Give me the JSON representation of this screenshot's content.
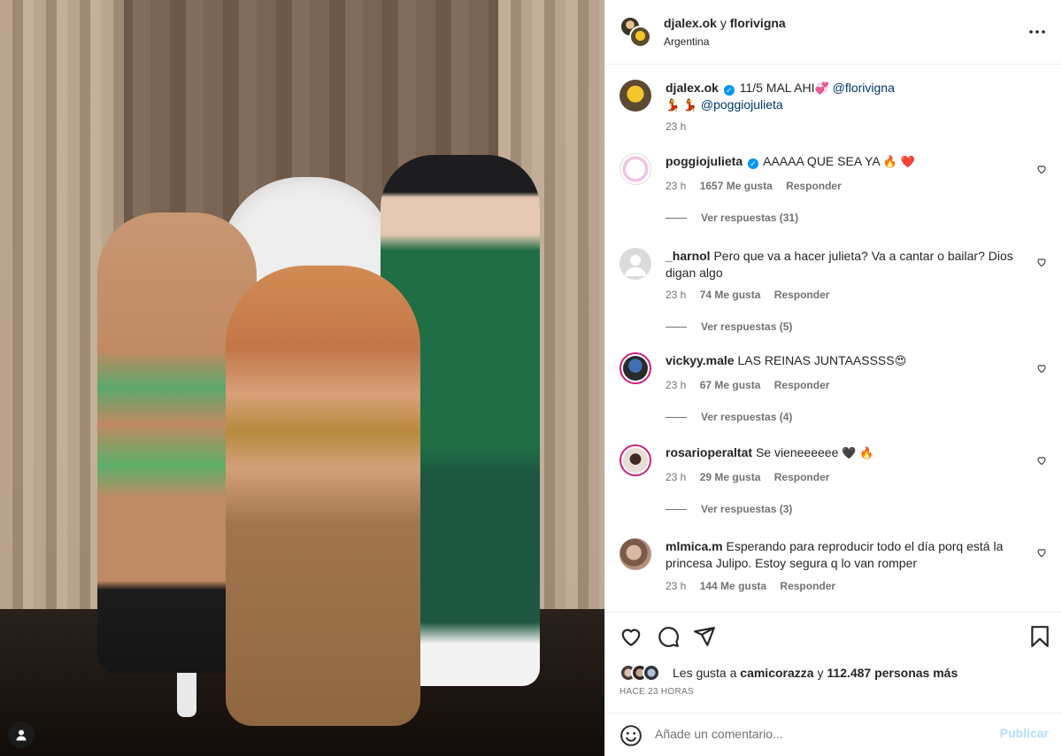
{
  "post": {
    "header": {
      "user1": "djalex.ok",
      "joiner": "y",
      "user2": "florivigna",
      "location": "Argentina",
      "more_icon": "more-horizontal-icon"
    },
    "caption": {
      "username": "djalex.ok",
      "text": "11/5 MAL AHI",
      "emoji1": "💞",
      "mention1": "@florivigna",
      "emoji2": "💃 💃",
      "mention2": "@poggiojulieta",
      "time": "23 h"
    },
    "comments": [
      {
        "username": "poggiojulieta",
        "verified": true,
        "text": "AAAAA QUE SEA YA",
        "emoji": "🔥 ❤️",
        "time": "23 h",
        "likes": "1657 Me gusta",
        "reply": "Responder",
        "replies": "Ver respuestas (31)"
      },
      {
        "username": "_harnol",
        "verified": false,
        "text": "Pero que va a hacer julieta? Va a cantar o bailar? Dios digan algo",
        "emoji": "",
        "time": "23 h",
        "likes": "74 Me gusta",
        "reply": "Responder",
        "replies": "Ver respuestas (5)"
      },
      {
        "username": "vickyy.male",
        "verified": false,
        "text": "LAS REINAS JUNTAASSSS",
        "emoji": "😍",
        "time": "23 h",
        "likes": "67 Me gusta",
        "reply": "Responder",
        "replies": "Ver respuestas (4)"
      },
      {
        "username": "rosarioperaltat",
        "verified": false,
        "text": "Se vieneeeeee",
        "emoji": "🖤 🔥",
        "time": "23 h",
        "likes": "29 Me gusta",
        "reply": "Responder",
        "replies": "Ver respuestas (3)"
      },
      {
        "username": "mlmica.m",
        "verified": false,
        "text": "Esperando para reproducir todo el día porq está la princesa Julipo. Estoy segura q lo van romper",
        "emoji": "",
        "time": "23 h",
        "likes": "144 Me gusta",
        "reply": "Responder",
        "replies": ""
      }
    ],
    "likes": {
      "prefix": "Les gusta a",
      "user": "camicorazza",
      "joiner": "y",
      "others": "112.487 personas más"
    },
    "posted_ago": "HACE 23 HORAS",
    "composer": {
      "placeholder": "Añade un comentario...",
      "post_label": "Publicar"
    }
  },
  "colors": {
    "link": "#00376b",
    "muted": "#737373",
    "post_button": "#b2dffc",
    "story_ring": "#d0207a",
    "verified": "#0095f6"
  }
}
